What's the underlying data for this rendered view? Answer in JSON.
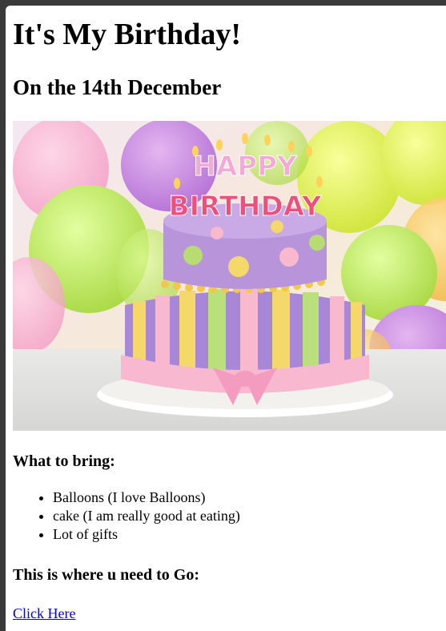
{
  "page": {
    "title": "It's My Birthday!",
    "subtitle": "On the 14th December"
  },
  "hero_image": {
    "cake_text_top": "HAPPY",
    "cake_text_bottom": "BIRTHDAY"
  },
  "bring": {
    "heading": "What to bring:",
    "items": [
      "Balloons (I love Balloons)",
      "cake (I am really good at eating)",
      "Lot of gifts"
    ]
  },
  "directions": {
    "heading": "This is where u need to Go:",
    "link_label": "Click Here"
  }
}
